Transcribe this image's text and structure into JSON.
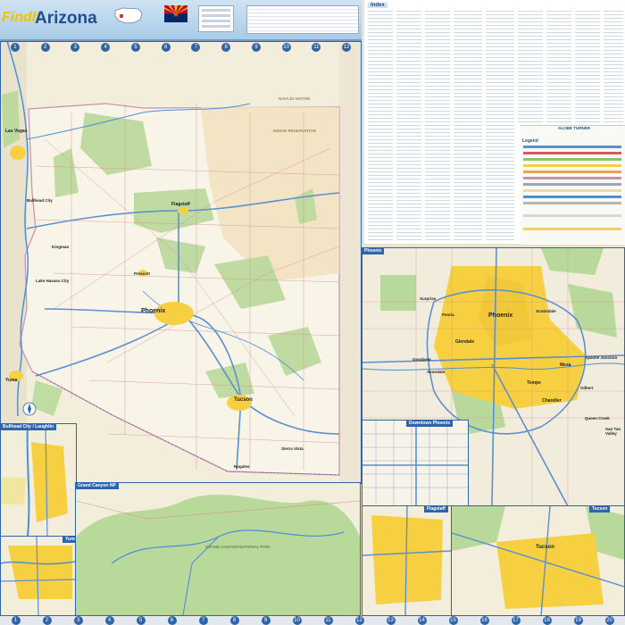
{
  "header": {
    "title_prefix": "FindIt",
    "title_state": "Arizona"
  },
  "index": {
    "title": "Index"
  },
  "legend": {
    "title": "Legend",
    "brand": "GLOBE TURNER"
  },
  "main_map": {
    "cities": [
      "Phoenix",
      "Las Vegas",
      "Flagstaff",
      "Tucson",
      "Yuma",
      "Bullhead City",
      "Kingman",
      "Prescott",
      "Nogales",
      "Sierra Vista",
      "Lake Havasu City"
    ],
    "regions": [
      "NAVAJO NATION",
      "INDIAN RESERVATION",
      "GRAND CANYON NATIONAL PARK"
    ],
    "compass": "N"
  },
  "insets": {
    "phoenix": "Phoenix",
    "downtown_phoenix": "Downtown Phoenix",
    "bullhead": "Bullhead City / Laughlin",
    "yuma": "Yuma",
    "grand_canyon": "Grand Canyon NP",
    "flagstaff": "Flagstaff",
    "tucson": "Tucson"
  },
  "phoenix_inset_cities": [
    "Phoenix",
    "Scottsdale",
    "Mesa",
    "Tempe",
    "Glendale",
    "Chandler",
    "Gilbert",
    "Peoria",
    "Surprise",
    "Goodyear",
    "Avondale",
    "Apache Junction",
    "Queen Creek",
    "San Tan Valley"
  ],
  "grid_numbers": [
    "1",
    "2",
    "3",
    "4",
    "5",
    "6",
    "7",
    "8",
    "9",
    "10",
    "11",
    "12",
    "13",
    "14",
    "15",
    "16",
    "17",
    "18",
    "19",
    "20"
  ],
  "colors": {
    "water": "#4a90d9",
    "park": "#b9d99a",
    "urban": "#f6d040",
    "highway": "#5b8fd0",
    "border": "#2f64a8",
    "reservation": "#f0d9b0"
  }
}
